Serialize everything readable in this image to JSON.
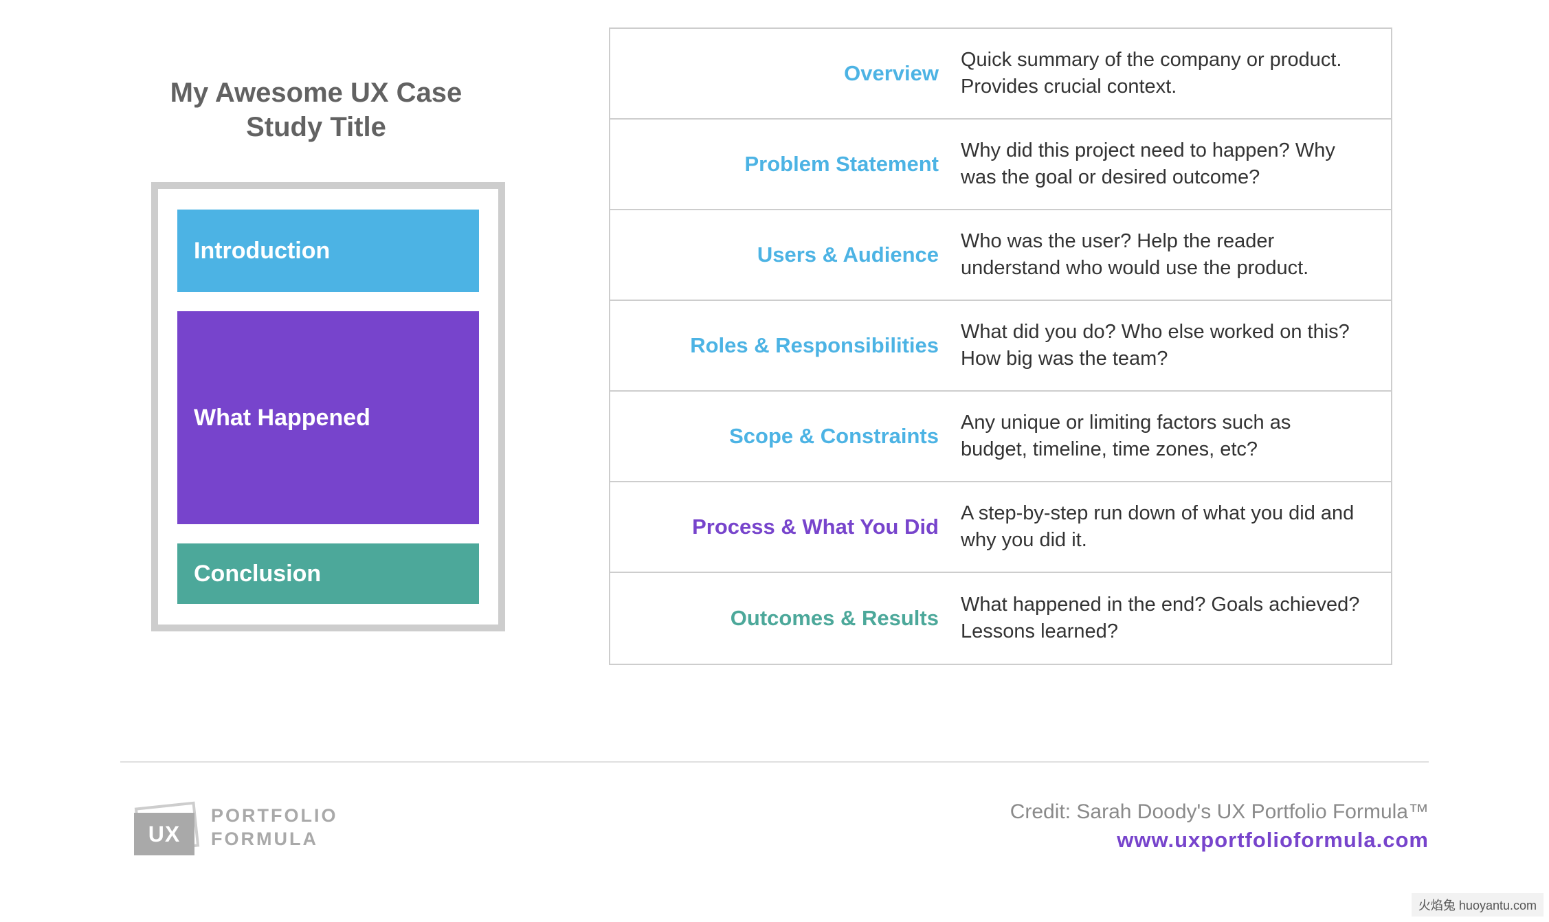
{
  "case_title": "My Awesome UX Case Study Title",
  "blocks": {
    "intro": "Introduction",
    "what": "What Happened",
    "conclusion": "Conclusion"
  },
  "rows": [
    {
      "label": "Overview",
      "color": "blue",
      "desc": "Quick summary of the company or product. Provides crucial context."
    },
    {
      "label": "Problem Statement",
      "color": "blue",
      "desc": "Why did this project need to happen? Why was the goal or desired outcome?"
    },
    {
      "label": "Users & Audience",
      "color": "blue",
      "desc": "Who was the user? Help the reader understand who would use the product."
    },
    {
      "label": "Roles & Responsibilities",
      "color": "blue",
      "desc": "What did you do? Who else worked on this? How big was the team?"
    },
    {
      "label": "Scope & Constraints",
      "color": "blue",
      "desc": "Any unique or limiting factors such as budget, timeline, time zones, etc?"
    },
    {
      "label": "Process & What You Did",
      "color": "purple",
      "desc": "A step-by-step run down of what you did and why you did it."
    },
    {
      "label": "Outcomes & Results",
      "color": "teal",
      "desc": "What happened in the end? Goals achieved? Lessons learned?"
    }
  ],
  "logo": {
    "badge": "UX",
    "line1": "PORTFOLIO",
    "line2": "FORMULA"
  },
  "credit": {
    "text": "Credit: Sarah Doody's UX Portfolio Formula™",
    "url": "www.uxportfolioformula.com"
  },
  "watermark": "火焰兔 huoyantu.com"
}
